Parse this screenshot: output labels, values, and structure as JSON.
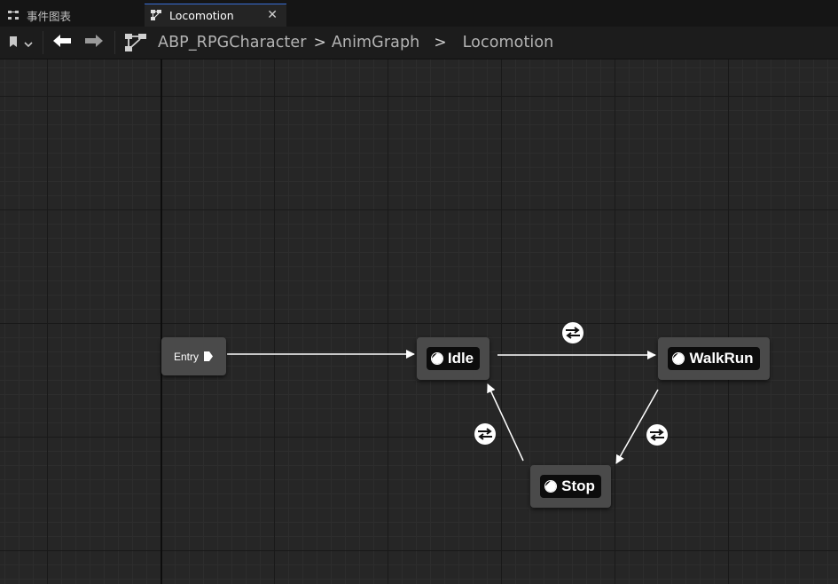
{
  "tabs": [
    {
      "label": "事件图表",
      "icon": "event-graph-icon",
      "active": false
    },
    {
      "label": "Locomotion",
      "icon": "state-machine-icon",
      "active": true
    }
  ],
  "breadcrumb": {
    "items": [
      "ABP_RPGCharacter",
      "AnimGraph",
      "Locomotion"
    ],
    "separator": ">"
  },
  "graph": {
    "entry": {
      "label": "Entry"
    },
    "states": [
      {
        "id": "idle",
        "label": "Idle"
      },
      {
        "id": "walkrun",
        "label": "WalkRun"
      },
      {
        "id": "stop",
        "label": "Stop"
      }
    ],
    "transitions": [
      {
        "from": "entry",
        "to": "idle"
      },
      {
        "from": "idle",
        "to": "walkrun"
      },
      {
        "from": "walkrun",
        "to": "stop"
      },
      {
        "from": "stop",
        "to": "idle"
      }
    ]
  },
  "colors": {
    "canvas": "#262626",
    "node": "#4a4a4a",
    "state_inner": "#0c0c0c",
    "wire": "#ffffff",
    "active_tab_accent": "#3a6fd6"
  }
}
